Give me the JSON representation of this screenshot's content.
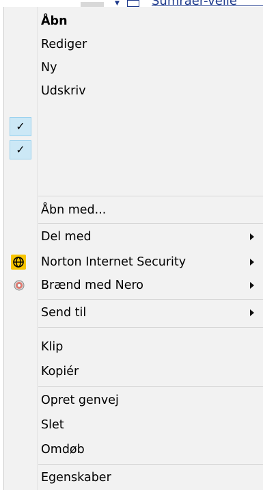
{
  "menu": {
    "items": [
      {
        "label": "Åbn",
        "default": true
      },
      {
        "label": "Rediger"
      },
      {
        "label": "Ny"
      },
      {
        "label": "Udskriv"
      },
      {
        "label": "Åbn med..."
      },
      {
        "label": "Del med",
        "submenu": true
      },
      {
        "label": "Norton Internet Security",
        "submenu": true,
        "icon": "norton-globe-icon"
      },
      {
        "label": "Brænd med Nero",
        "submenu": true,
        "icon": "nero-disc-icon"
      },
      {
        "label": "Send til",
        "submenu": true
      },
      {
        "label": "Klip"
      },
      {
        "label": "Kopiér"
      },
      {
        "label": "Opret genvej"
      },
      {
        "label": "Slet"
      },
      {
        "label": "Omdøb"
      },
      {
        "label": "Egenskaber"
      }
    ],
    "checks": [
      {
        "symbol": "✓",
        "checked": true
      },
      {
        "symbol": "✓",
        "checked": true
      }
    ]
  },
  "background": {
    "partial_text": "Sumraer-velle"
  },
  "colors": {
    "menu_bg": "#f2f2f2",
    "check_highlight": "#cce8f6",
    "norton_yellow": "#f7c400",
    "separator": "#d7d7d7"
  }
}
